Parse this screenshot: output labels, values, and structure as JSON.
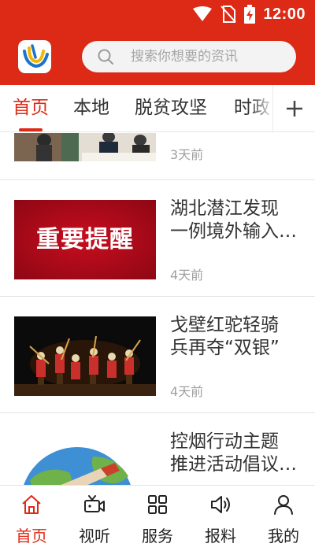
{
  "status_bar": {
    "time": "12:00"
  },
  "header": {
    "search_placeholder": "搜索你想要的资讯"
  },
  "tabs": [
    {
      "label": "首页",
      "active": true
    },
    {
      "label": "本地",
      "active": false
    },
    {
      "label": "脱贫攻坚",
      "active": false
    },
    {
      "label": "时政",
      "active": false
    }
  ],
  "news": [
    {
      "title_lines": [],
      "time": "3天前",
      "thumb": "meeting-photo"
    },
    {
      "title_lines": [
        "湖北潜江发现",
        "一例境外输入…"
      ],
      "time": "4天前",
      "thumb": "important-notice",
      "thumb_text": "重要提醒"
    },
    {
      "title_lines": [
        "戈壁红驼轻骑",
        "兵再夺“双银”"
      ],
      "time": "4天前",
      "thumb": "stage-performance"
    },
    {
      "title_lines": [
        "控烟行动主题",
        "推进活动倡议…"
      ],
      "time": "",
      "thumb": "no-smoking-illustration"
    }
  ],
  "bottom_nav": [
    {
      "label": "首页",
      "icon": "home-icon",
      "active": true
    },
    {
      "label": "视听",
      "icon": "video-camera-icon",
      "active": false
    },
    {
      "label": "服务",
      "icon": "grid-icon",
      "active": false
    },
    {
      "label": "报料",
      "icon": "speaker-icon",
      "active": false
    },
    {
      "label": "我的",
      "icon": "user-icon",
      "active": false
    }
  ],
  "colors": {
    "brand_red": "#dc2a16",
    "text": "#333333",
    "muted": "#a0a0a0",
    "search_bg": "#f3f3f3"
  }
}
